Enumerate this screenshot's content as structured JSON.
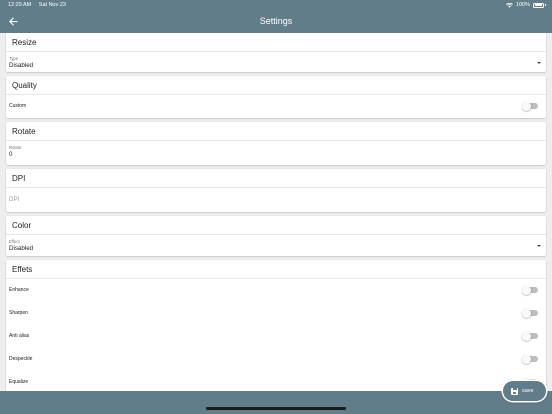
{
  "status_bar": {
    "time": "12:29 AM",
    "date": "Sat Nov 23",
    "battery": "100%"
  },
  "app_bar": {
    "title": "Settings"
  },
  "resize": {
    "header": "Resize",
    "type_label": "Type",
    "type_value": "Disabled"
  },
  "quality": {
    "header": "Quality",
    "custom_label": "Custom",
    "custom_on": false
  },
  "rotate": {
    "header": "Rotate",
    "rotate_label": "Rotate",
    "rotate_value": "0"
  },
  "dpi": {
    "header": "DPI",
    "placeholder": "DPI"
  },
  "color": {
    "header": "Color",
    "effect_label": "Effect",
    "effect_value": "Disabled"
  },
  "effects": {
    "header": "Effets",
    "items": [
      {
        "label": "Enhance",
        "on": false
      },
      {
        "label": "Sharpen",
        "on": false
      },
      {
        "label": "Anti alias",
        "on": false
      },
      {
        "label": "Despeckle",
        "on": false
      },
      {
        "label": "Equalize",
        "on": false
      }
    ]
  },
  "fab": {
    "label": "save"
  },
  "colors": {
    "primary": "#627d8a",
    "background": "#eeeeee",
    "card": "#ffffff",
    "toggle_off": "#bdbdbd"
  }
}
